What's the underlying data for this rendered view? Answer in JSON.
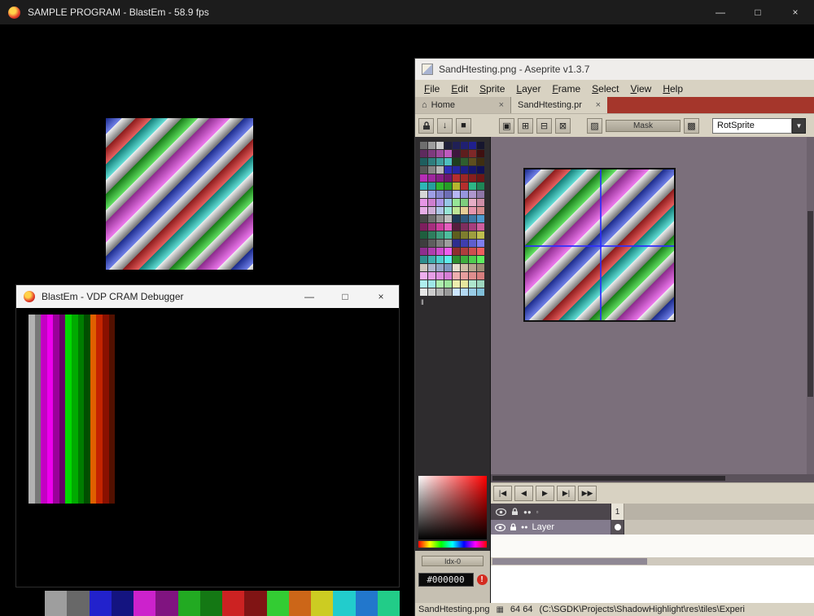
{
  "glyphs": {
    "minimize": "—",
    "maximize": "□",
    "close": "×",
    "home": "⌂",
    "tab_close": "×",
    "arrow_down": "▼",
    "menu_down": "↓",
    "square": "■",
    "sel_replace": "▣",
    "sel_add": "⊞",
    "sel_subtract": "⊟",
    "sel_intersect": "⊠",
    "pattern": "▨",
    "grid": "▩",
    "dots": "●●",
    "tiny_square": "▫",
    "sprite_icon": "▦",
    "palette_marker": "‖",
    "warning": "!"
  },
  "desktop": {
    "main_window": {
      "title": "SAMPLE PROGRAM - BlastEm - 58.9 fps"
    },
    "cram_window": {
      "title": "BlastEm - VDP CRAM Debugger",
      "stripes": [
        "#b2b2b2",
        "#787878",
        "#c400c4",
        "#ee00ee",
        "#9a009a",
        "#660066",
        "#00d800",
        "#00aa00",
        "#007c00",
        "#004e00",
        "#e06000",
        "#c42400",
        "#8a1000",
        "#521000"
      ]
    },
    "bottom_palette": [
      "#9e9e9e",
      "#686868",
      "#2222cc",
      "#141480",
      "#cc22cc",
      "#801480",
      "#22aa22",
      "#147814",
      "#cc2222",
      "#801414",
      "#33cc33",
      "#cc6618",
      "#cccc22",
      "#22cccc",
      "#2277cc",
      "#22cc88"
    ],
    "sprite": {
      "bands": [
        {
          "from": "#1a2a8c",
          "to": "#7080e8",
          "w": 14
        },
        {
          "from": "#f0f0f0",
          "to": "#787878",
          "w": 12
        },
        {
          "from": "#8c1a1a",
          "to": "#e86060",
          "w": 14
        },
        {
          "from": "#0f7a74",
          "to": "#66e0d8",
          "w": 14
        },
        {
          "from": "#f0f0f0",
          "to": "#787878",
          "w": 12
        },
        {
          "from": "#167a16",
          "to": "#62e062",
          "w": 14
        },
        {
          "from": "#e8e8e8",
          "to": "#808080",
          "w": 10
        },
        {
          "from": "#8c2a8c",
          "to": "#ee7aee",
          "w": 18
        },
        {
          "from": "#f0f0f0",
          "to": "#707070",
          "w": 12
        }
      ]
    }
  },
  "aseprite": {
    "title": "SandHtesting.png - Aseprite v1.3.7",
    "menus": [
      "File",
      "Edit",
      "Sprite",
      "Layer",
      "Frame",
      "Select",
      "View",
      "Help"
    ],
    "tabs": [
      {
        "label": "Home"
      },
      {
        "label": "SandHtesting.pr",
        "active": true
      }
    ],
    "context_bar": {
      "mask_label": "Mask",
      "algorithm": "RotSprite"
    },
    "colors": {
      "tabbar_bg": "#a5362b",
      "canvas_bg": "#7b6f7b",
      "ui_bg": "#d8d2c2",
      "panel_dark": "#2e2c2e"
    },
    "palette": {
      "rows": [
        [
          "#6e6e6e",
          "#9e9e9e",
          "#cecece",
          "#20203a",
          "#202056",
          "#202072",
          "#20208e",
          "#16162e"
        ],
        [
          "#5e2a5e",
          "#7e3a7e",
          "#9e4a9e",
          "#be5abe",
          "#3e163e",
          "#5e1e1e",
          "#7e2828",
          "#3e1010"
        ],
        [
          "#1e5e5e",
          "#2e7e7e",
          "#3e9e9e",
          "#4ebebe",
          "#1e3e1e",
          "#2e5e2e",
          "#5e4e1e",
          "#3e2e10"
        ],
        [
          "#565656",
          "#868686",
          "#b6b6b6",
          "#2e2eb6",
          "#26269e",
          "#1e1e86",
          "#16166e",
          "#101056"
        ],
        [
          "#b62eb6",
          "#9e269e",
          "#861e86",
          "#6e166e",
          "#b62e2e",
          "#9e2626",
          "#861e1e",
          "#6e1616"
        ],
        [
          "#2eb6b6",
          "#269e9e",
          "#2eb62e",
          "#269e26",
          "#b6b62e",
          "#b62e2e",
          "#2eb686",
          "#1e8656"
        ],
        [
          "#d6d6d6",
          "#9e9ee6",
          "#8686ce",
          "#6e6eb6",
          "#b6b6f6",
          "#9696de",
          "#ae96ce",
          "#8e76a6"
        ],
        [
          "#e696e6",
          "#ce7ece",
          "#ae96e6",
          "#96c6e6",
          "#96e696",
          "#7ece7e",
          "#e6aec6",
          "#ce8ea6"
        ],
        [
          "#e6aee6",
          "#ceaed6",
          "#aec6e6",
          "#96e6d6",
          "#bee696",
          "#e6ce96",
          "#e696ae",
          "#d68e8e"
        ],
        [
          "#464646",
          "#6e6e6e",
          "#969696",
          "#bebebe",
          "#1e3a56",
          "#2e5a7e",
          "#3e7aa6",
          "#4e9ace"
        ],
        [
          "#7e1e5e",
          "#a62e7e",
          "#ce3e9e",
          "#e65ebe",
          "#561e3e",
          "#7e2e5e",
          "#a63e7e",
          "#ce5e9e"
        ],
        [
          "#1e5e3e",
          "#2e7e5e",
          "#3e9e7e",
          "#4ebe9e",
          "#5e5e1e",
          "#7e7e2e",
          "#9e9e3e",
          "#bebe4e"
        ],
        [
          "#3e3e3e",
          "#5e5e5e",
          "#7e7e7e",
          "#9e9e9e",
          "#2e2e8e",
          "#3e3eae",
          "#5e5ece",
          "#7e7eee"
        ],
        [
          "#8e2e8e",
          "#ae3eae",
          "#ce4ece",
          "#ee5eee",
          "#8e2e2e",
          "#ae3e3e",
          "#ce4e4e",
          "#ee5e5e"
        ],
        [
          "#2e8e8e",
          "#3eaeae",
          "#4ecece",
          "#5eeeee",
          "#2e8e2e",
          "#3eae3e",
          "#4ece4e",
          "#5eee5e"
        ],
        [
          "#cec6be",
          "#aeb6ce",
          "#96a6c6",
          "#7e96be",
          "#e6dece",
          "#cebea6",
          "#b6a68e",
          "#9e8e76"
        ],
        [
          "#eeaeee",
          "#e69ee6",
          "#de8ede",
          "#d67ed6",
          "#eeaeae",
          "#e69e9e",
          "#de8e8e",
          "#d67e7e"
        ],
        [
          "#aeeeee",
          "#9ee6e6",
          "#aeeeae",
          "#9ee69e",
          "#eeeeae",
          "#e6e69e",
          "#aee6ce",
          "#9ed6be"
        ],
        [
          "#e6e6e6",
          "#cccccc",
          "#b3b3b3",
          "#999999",
          "#cce6ff",
          "#b3d9f2",
          "#99cce6",
          "#80bfd9"
        ]
      ]
    },
    "color": {
      "hex": "#000000",
      "index_label": "Idx-0"
    },
    "playback": [
      "|◀",
      "◀",
      "▶",
      "▶|",
      "▶▶"
    ],
    "timeline": {
      "frame": "1",
      "layer_name": "Layer"
    },
    "status": {
      "filename": "SandHtesting.png",
      "size": "64 64",
      "path": "(C:\\SGDK\\Projects\\ShadowHighlight\\res\\tiles\\Experi"
    }
  }
}
